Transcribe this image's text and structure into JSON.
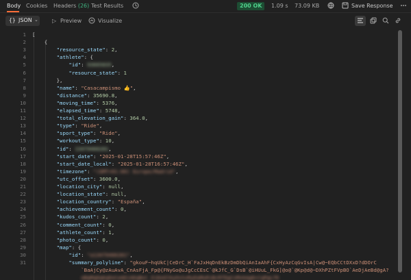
{
  "tabs": [
    {
      "label": "Body"
    },
    {
      "label": "Cookies"
    },
    {
      "label": "Headers",
      "count": "(26)"
    },
    {
      "label": "Test Results"
    }
  ],
  "status": {
    "code": "200 OK",
    "time": "1.09 s",
    "size": "73.09 KB"
  },
  "actions": {
    "save_response": "Save Response"
  },
  "toolbar": {
    "format": "JSON",
    "preview": "Preview",
    "visualize": "Visualize"
  },
  "icons": [
    "history-icon",
    "globe-icon",
    "save-icon",
    "more-icon",
    "wrap-icon",
    "copy-icon",
    "search-icon",
    "link-icon"
  ],
  "colors": {
    "accent": "#ff6c37",
    "status_bg": "#1d4d33",
    "status_text": "#4fd18b",
    "key": "#9cdcfe",
    "string": "#ce9178",
    "number": "#b5cea8"
  },
  "code_lines": [
    {
      "n": "1",
      "t": [
        {
          "c": "p",
          "v": "["
        }
      ]
    },
    {
      "n": "2",
      "t": [
        {
          "c": "p",
          "v": "    {"
        }
      ]
    },
    {
      "n": "3",
      "t": [
        {
          "c": "k",
          "v": "        \"resource_state\""
        },
        {
          "c": "p",
          "v": ": "
        },
        {
          "c": "n",
          "v": "2"
        },
        {
          "c": "p",
          "v": ","
        }
      ]
    },
    {
      "n": "4",
      "t": [
        {
          "c": "k",
          "v": "        \"athlete\""
        },
        {
          "c": "p",
          "v": ": {"
        }
      ]
    },
    {
      "n": "5",
      "t": [
        {
          "c": "k",
          "v": "            \"id\""
        },
        {
          "c": "p",
          "v": ": "
        },
        {
          "c": "n b",
          "v": "93665835"
        },
        {
          "c": "p",
          "v": ","
        }
      ]
    },
    {
      "n": "6",
      "t": [
        {
          "c": "k",
          "v": "            \"resource_state\""
        },
        {
          "c": "p",
          "v": ": "
        },
        {
          "c": "n",
          "v": "1"
        }
      ]
    },
    {
      "n": "7",
      "t": [
        {
          "c": "p",
          "v": "        },"
        }
      ]
    },
    {
      "n": "8",
      "t": [
        {
          "c": "k",
          "v": "        \"name\""
        },
        {
          "c": "p",
          "v": ": "
        },
        {
          "c": "s",
          "v": "\"Casacampismo 👍\""
        },
        {
          "c": "p",
          "v": ","
        }
      ]
    },
    {
      "n": "9",
      "t": [
        {
          "c": "k",
          "v": "        \"distance\""
        },
        {
          "c": "p",
          "v": ": "
        },
        {
          "c": "n",
          "v": "35690.8"
        },
        {
          "c": "p",
          "v": ","
        }
      ]
    },
    {
      "n": "10",
      "t": [
        {
          "c": "k",
          "v": "        \"moving_time\""
        },
        {
          "c": "p",
          "v": ": "
        },
        {
          "c": "n",
          "v": "5376"
        },
        {
          "c": "p",
          "v": ","
        }
      ]
    },
    {
      "n": "11",
      "t": [
        {
          "c": "k",
          "v": "        \"elapsed_time\""
        },
        {
          "c": "p",
          "v": ": "
        },
        {
          "c": "n",
          "v": "5748"
        },
        {
          "c": "p",
          "v": ","
        }
      ]
    },
    {
      "n": "12",
      "t": [
        {
          "c": "k",
          "v": "        \"total_elevation_gain\""
        },
        {
          "c": "p",
          "v": ": "
        },
        {
          "c": "n",
          "v": "364.0"
        },
        {
          "c": "p",
          "v": ","
        }
      ]
    },
    {
      "n": "13",
      "t": [
        {
          "c": "k",
          "v": "        \"type\""
        },
        {
          "c": "p",
          "v": ": "
        },
        {
          "c": "s",
          "v": "\"Ride\""
        },
        {
          "c": "p",
          "v": ","
        }
      ]
    },
    {
      "n": "14",
      "t": [
        {
          "c": "k",
          "v": "        \"sport_type\""
        },
        {
          "c": "p",
          "v": ": "
        },
        {
          "c": "s",
          "v": "\"Ride\""
        },
        {
          "c": "p",
          "v": ","
        }
      ]
    },
    {
      "n": "15",
      "t": [
        {
          "c": "k",
          "v": "        \"workout_type\""
        },
        {
          "c": "p",
          "v": ": "
        },
        {
          "c": "n",
          "v": "10"
        },
        {
          "c": "p",
          "v": ","
        }
      ]
    },
    {
      "n": "16",
      "t": [
        {
          "c": "k",
          "v": "        \"id\""
        },
        {
          "c": "p",
          "v": ": "
        },
        {
          "c": "n b",
          "v": "13479466281"
        },
        {
          "c": "p",
          "v": ","
        }
      ]
    },
    {
      "n": "17",
      "t": [
        {
          "c": "k",
          "v": "        \"start_date\""
        },
        {
          "c": "p",
          "v": ": "
        },
        {
          "c": "s",
          "v": "\"2025-01-28T15:57:46Z\""
        },
        {
          "c": "p",
          "v": ","
        }
      ]
    },
    {
      "n": "18",
      "t": [
        {
          "c": "k",
          "v": "        \"start_date_local\""
        },
        {
          "c": "p",
          "v": ": "
        },
        {
          "c": "s",
          "v": "\"2025-01-28T16:57:46Z\""
        },
        {
          "c": "p",
          "v": ","
        }
      ]
    },
    {
      "n": "19",
      "t": [
        {
          "c": "k",
          "v": "        \"timezone\""
        },
        {
          "c": "p",
          "v": ": "
        },
        {
          "c": "s b",
          "v": "\"(GMT+01:00) Europe/Madrid\""
        },
        {
          "c": "p",
          "v": ","
        }
      ]
    },
    {
      "n": "20",
      "t": [
        {
          "c": "k",
          "v": "        \"utc_offset\""
        },
        {
          "c": "p",
          "v": ": "
        },
        {
          "c": "n",
          "v": "3600.0"
        },
        {
          "c": "p",
          "v": ","
        }
      ]
    },
    {
      "n": "21",
      "t": [
        {
          "c": "k",
          "v": "        \"location_city\""
        },
        {
          "c": "p",
          "v": ": "
        },
        {
          "c": "n",
          "v": "null"
        },
        {
          "c": "p",
          "v": ","
        }
      ]
    },
    {
      "n": "22",
      "t": [
        {
          "c": "k",
          "v": "        \"location_state\""
        },
        {
          "c": "p",
          "v": ": "
        },
        {
          "c": "n",
          "v": "null"
        },
        {
          "c": "p",
          "v": ","
        }
      ]
    },
    {
      "n": "23",
      "t": [
        {
          "c": "k",
          "v": "        \"location_country\""
        },
        {
          "c": "p",
          "v": ": "
        },
        {
          "c": "s",
          "v": "\"España\""
        },
        {
          "c": "p",
          "v": ","
        }
      ]
    },
    {
      "n": "24",
      "t": [
        {
          "c": "k",
          "v": "        \"achievement_count\""
        },
        {
          "c": "p",
          "v": ": "
        },
        {
          "c": "n",
          "v": "0"
        },
        {
          "c": "p",
          "v": ","
        }
      ]
    },
    {
      "n": "25",
      "t": [
        {
          "c": "k",
          "v": "        \"kudos_count\""
        },
        {
          "c": "p",
          "v": ": "
        },
        {
          "c": "n",
          "v": "2"
        },
        {
          "c": "p",
          "v": ","
        }
      ]
    },
    {
      "n": "26",
      "t": [
        {
          "c": "k",
          "v": "        \"comment_count\""
        },
        {
          "c": "p",
          "v": ": "
        },
        {
          "c": "n",
          "v": "0"
        },
        {
          "c": "p",
          "v": ","
        }
      ]
    },
    {
      "n": "27",
      "t": [
        {
          "c": "k",
          "v": "        \"athlete_count\""
        },
        {
          "c": "p",
          "v": ": "
        },
        {
          "c": "n",
          "v": "1"
        },
        {
          "c": "p",
          "v": ","
        }
      ]
    },
    {
      "n": "28",
      "t": [
        {
          "c": "k",
          "v": "        \"photo_count\""
        },
        {
          "c": "p",
          "v": ": "
        },
        {
          "c": "n",
          "v": "0"
        },
        {
          "c": "p",
          "v": ","
        }
      ]
    },
    {
      "n": "29",
      "t": [
        {
          "c": "k",
          "v": "        \"map\""
        },
        {
          "c": "p",
          "v": ": {"
        }
      ]
    },
    {
      "n": "30",
      "t": [
        {
          "c": "k",
          "v": "            \"id\""
        },
        {
          "c": "p",
          "v": ": "
        },
        {
          "c": "s b",
          "v": "\"a13479466281\""
        },
        {
          "c": "p",
          "v": ","
        }
      ]
    },
    {
      "n": "31",
      "t": [
        {
          "c": "k",
          "v": "            \"summary_polyline\""
        },
        {
          "c": "p",
          "v": ": "
        },
        {
          "c": "s",
          "v": "\"gkouF~hqUkC|CeDrC_H`FaJxHqDnEkBzDmDbQiAnIaAhF{CxHyAzCqGvIsA|Cw@~EQbCCtDXxD?dDOrC"
        }
      ]
    },
    {
      "n": "",
      "t": [
        {
          "c": "s",
          "v": "                `BaAjCy@zAuAvA_CnAsFjA_Fp@{FNyGo@uJgCcCEsC`@kJfC_G`DsB`@iHUuL_FkG]@o@`@Kp@d@~DXhPZtFVpBO`AeDjAeBd@gA?"
        }
      ]
    },
    {
      "n": "",
      "t": [
        {
          "c": "s b",
          "v": "                eBqMqDqKqEeCeAEiAEqBsC_EiDoGlKyOsSvRyEaMuRiBcRfEgCsMvkAgDcCqPgLfK"
        }
      ]
    }
  ]
}
